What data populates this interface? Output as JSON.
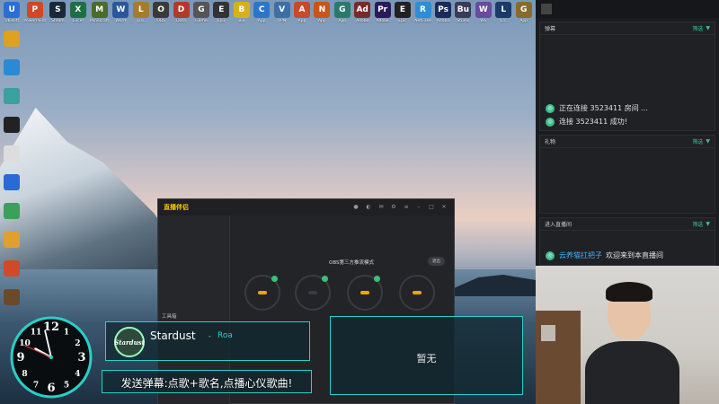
{
  "desktop": {
    "top_icons": [
      {
        "glyph": "U",
        "label": "Ubisoft",
        "color": "#2b6fd6"
      },
      {
        "glyph": "P",
        "label": "PowerPoint",
        "color": "#d24726"
      },
      {
        "glyph": "S",
        "label": "Steam",
        "color": "#1b2838"
      },
      {
        "glyph": "X",
        "label": "Excel",
        "color": "#1d7044"
      },
      {
        "glyph": "M",
        "label": "Minecraft",
        "color": "#4a6b2a"
      },
      {
        "glyph": "W",
        "label": "Word",
        "color": "#2b579a"
      },
      {
        "glyph": "L",
        "label": "LOL",
        "color": "#a67c2a"
      },
      {
        "glyph": "O",
        "label": "OBS",
        "color": "#3a3a3a"
      },
      {
        "glyph": "D",
        "label": "Dota",
        "color": "#b33a2a"
      },
      {
        "glyph": "G",
        "label": "Game",
        "color": "#555"
      },
      {
        "glyph": "E",
        "label": "Epic",
        "color": "#333"
      },
      {
        "glyph": "B",
        "label": "Bili",
        "color": "#d8b11a"
      },
      {
        "glyph": "C",
        "label": "App",
        "color": "#2a77c9"
      },
      {
        "glyph": "V",
        "label": "VPN",
        "color": "#3d6ea8"
      },
      {
        "glyph": "A",
        "label": "App",
        "color": "#c84a2a"
      },
      {
        "glyph": "N",
        "label": "App",
        "color": "#c8551a"
      },
      {
        "glyph": "G",
        "label": "App",
        "color": "#2a7a6a"
      },
      {
        "glyph": "Ad",
        "label": "Adobe",
        "color": "#7a2a2a"
      },
      {
        "glyph": "Pr",
        "label": "Adobe",
        "color": "#2a1a5a"
      },
      {
        "glyph": "E",
        "label": "Epic",
        "color": "#222"
      },
      {
        "glyph": "R",
        "label": "NetEase",
        "color": "#2a8fd6"
      },
      {
        "glyph": "Ps",
        "label": "Adobe",
        "color": "#1a2a5a"
      },
      {
        "glyph": "Bu",
        "label": "Studio",
        "color": "#3a3a5a"
      },
      {
        "glyph": "W",
        "label": "WE",
        "color": "#6a4aa0"
      },
      {
        "glyph": "L",
        "label": "Lrc",
        "color": "#1a3a6a"
      },
      {
        "glyph": "G",
        "label": "App",
        "color": "#8a6a2a"
      }
    ],
    "left_icons": [
      {
        "glyph": "",
        "label": "",
        "color": "#e0a020"
      },
      {
        "glyph": "",
        "label": "",
        "color": "#2a8ad6"
      },
      {
        "glyph": "",
        "label": "",
        "color": "#3aa0a0"
      },
      {
        "glyph": "",
        "label": "",
        "color": "#222"
      },
      {
        "glyph": "",
        "label": "",
        "color": "#ddd"
      },
      {
        "glyph": "",
        "label": "",
        "color": "#2a6ad6"
      },
      {
        "glyph": "",
        "label": "",
        "color": "#3aa05a"
      },
      {
        "glyph": "",
        "label": "",
        "color": "#e0a030"
      },
      {
        "glyph": "",
        "label": "",
        "color": "#d04a2a"
      },
      {
        "glyph": "",
        "label": "",
        "color": "#6a4a2a"
      }
    ]
  },
  "app": {
    "logo": "直播伴侣",
    "tabs": [
      "",
      ""
    ],
    "left_muted": "",
    "toolbox": "工具箱",
    "stream_info": "",
    "stream_sub": "",
    "obs_title": "OBS第三方推流模式",
    "obs_exit": "退出",
    "steps": [
      {
        "pill": "",
        "caption": ""
      },
      {
        "pill": "",
        "caption": ""
      },
      {
        "pill": "",
        "caption": ""
      },
      {
        "pill": "",
        "caption": ""
      }
    ]
  },
  "chat": {
    "music_bar": "",
    "danmaku_title": "弹幕",
    "filter_label": "筛选",
    "messages": [
      {
        "text": "正在连接 3523411 房间 ..."
      },
      {
        "text": "连接 3523411 成功!"
      }
    ],
    "gift_title": "礼物",
    "enter_title": "进入直播间",
    "enter_message": {
      "user": "云养猫扛把子",
      "text": "欢迎来到本直播间"
    }
  },
  "clock": {
    "numerals": [
      "12",
      "1",
      "2",
      "3",
      "4",
      "5",
      "6",
      "7",
      "8",
      "9",
      "10",
      "11"
    ],
    "hour": 9.0,
    "minute": 57,
    "second": 49
  },
  "overlays": {
    "now_playing_art": "Stardust",
    "now_playing_title": "Stardust",
    "now_playing_sep": "-",
    "now_playing_artist": "Roa",
    "queue_empty": "暂无",
    "banner": "发送弹幕:点歌+歌名,点播心仪歌曲!"
  },
  "colors": {
    "accent_teal": "#27d0c8",
    "accent_green": "#3cc08d",
    "app_bg": "#232428",
    "orange": "#f5a300"
  }
}
